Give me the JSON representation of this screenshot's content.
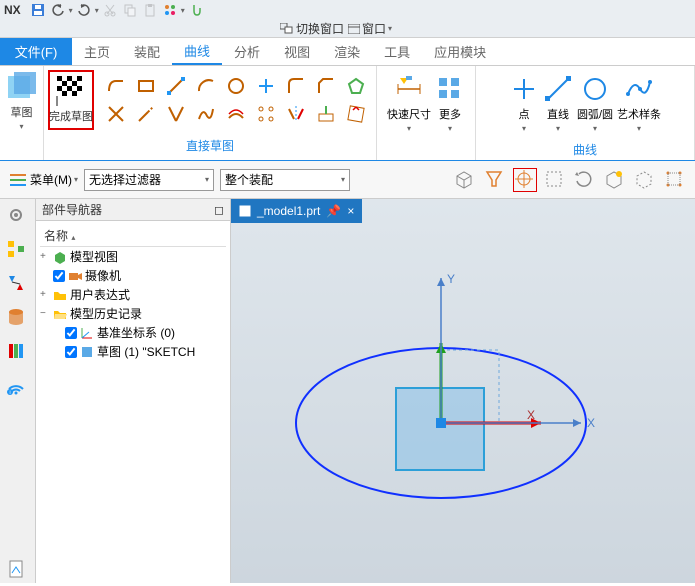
{
  "app": {
    "name": "NX"
  },
  "qat": {
    "save_icon": "save-icon",
    "undo_icon": "undo-icon",
    "redo_icon": "redo-icon",
    "cut_icon": "cut-icon",
    "copy_icon": "copy-icon",
    "paste_icon": "paste-icon",
    "props_icon": "props-icon",
    "touch_icon": "touch-icon"
  },
  "win": {
    "switch_window": "切换窗口",
    "window": "窗口"
  },
  "menu": {
    "file": "文件(F)",
    "tabs": [
      {
        "label": "主页"
      },
      {
        "label": "装配"
      },
      {
        "label": "曲线"
      },
      {
        "label": "分析"
      },
      {
        "label": "视图"
      },
      {
        "label": "渲染"
      },
      {
        "label": "工具"
      },
      {
        "label": "应用模块"
      }
    ],
    "active_index": 2
  },
  "ribbon": {
    "sketch_label": "草图",
    "finish_sketch_label": "完成草图",
    "direct_sketch_group": "直接草图",
    "quick_dim_label": "快速尺寸",
    "more_label": "更多",
    "point_label": "点",
    "line_label": "直线",
    "arc_label": "圆弧/圆",
    "spline_label": "艺术样条",
    "curve_group": "曲线"
  },
  "toolbar2": {
    "menu_label": "菜单(M)",
    "filter": "无选择过滤器",
    "assembly": "整个装配"
  },
  "nav": {
    "title": "部件导航器",
    "col_name": "名称",
    "items": {
      "model_view": "模型视图",
      "camera": "摄像机",
      "user_expr": "用户表达式",
      "history": "模型历史记录",
      "datum": "基准坐标系 (0)",
      "sketch": "草图 (1) \"SKETCH"
    }
  },
  "viewport": {
    "tab_label": "_model1.prt",
    "pin": "📌",
    "close": "×",
    "axes": {
      "x": "X",
      "y": "Y"
    }
  }
}
